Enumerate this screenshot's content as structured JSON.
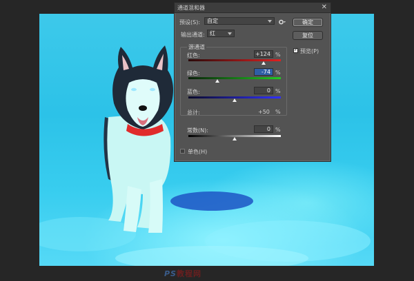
{
  "dialog": {
    "title": "通道混和器",
    "close": "✕",
    "preset_label": "预设(S):",
    "preset_value": "自定",
    "output_label": "输出通道:",
    "output_value": "红",
    "group_title": "源通道",
    "sources": [
      {
        "label": "红色:",
        "value": "+124",
        "percent": 124,
        "selected": false
      },
      {
        "label": "绿色:",
        "value": "-74",
        "percent": -74,
        "selected": true
      },
      {
        "label": "蓝色:",
        "value": "0",
        "percent": 0,
        "selected": false
      }
    ],
    "total_label": "总计:",
    "total_value": "+50",
    "constant_label": "常数(N):",
    "constant_value": "0",
    "constant_percent": 0,
    "percent_sign": "%",
    "monochrome_label": "单色(H)",
    "monochrome_checked": false,
    "ok_label": "确定",
    "reset_label": "复位",
    "preview_label": "预览(P)",
    "preview_checked": true,
    "gear_icon": "gear-icon"
  },
  "watermark": {
    "part1": "PS",
    "part2": "教程网"
  },
  "colors": {
    "app_background": "#262626",
    "dialog_background": "#535353",
    "selected_field": "#2f5fa6",
    "photo_tint": "#2cc2e8"
  }
}
